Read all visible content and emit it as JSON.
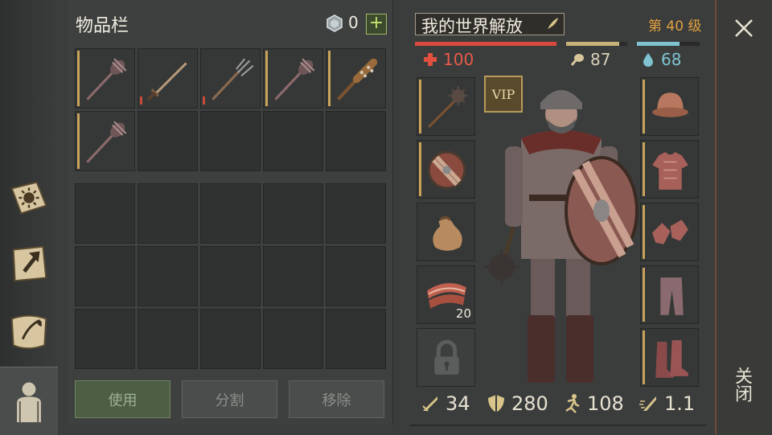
{
  "inventory": {
    "title": "物品栏",
    "currency_count": "0",
    "add_label": "+",
    "items": [
      {
        "icon": "mace-icon",
        "tier": "gold"
      },
      {
        "icon": "sword-icon",
        "tier": "red"
      },
      {
        "icon": "pitchfork-icon",
        "tier": "red"
      },
      {
        "icon": "mace-icon",
        "tier": "gold"
      },
      {
        "icon": "spiked-club-icon",
        "tier": "gold"
      },
      {
        "icon": "mace-icon",
        "tier": "gold"
      }
    ],
    "actions": {
      "use": "使用",
      "split": "分割",
      "remove": "移除"
    }
  },
  "character": {
    "name": "我的世界解放",
    "level": "第 40 级",
    "vip_label": "VIP",
    "health": "100",
    "food": "87",
    "water": "68",
    "health_fraction": 1.0,
    "food_fraction": 0.87,
    "water_fraction": 0.68,
    "left_slots": [
      {
        "icon": "mace-icon",
        "qty": ""
      },
      {
        "icon": "round-shield-icon",
        "qty": ""
      },
      {
        "icon": "sack-icon",
        "qty": ""
      },
      {
        "icon": "meat-icon",
        "qty": "20"
      },
      {
        "icon": "lock-icon",
        "qty": ""
      }
    ],
    "right_slots": [
      {
        "icon": "helmet-icon"
      },
      {
        "icon": "chainmail-icon"
      },
      {
        "icon": "gloves-icon"
      },
      {
        "icon": "trousers-icon"
      },
      {
        "icon": "boots-icon"
      }
    ],
    "stats": {
      "attack": "34",
      "armor": "280",
      "speed": "108",
      "attack_speed": "1.1"
    }
  },
  "close_label": "关闭",
  "colors": {
    "health": "#e85a4a",
    "food": "#c9b27a",
    "water": "#7fc3d1",
    "level": "#e3a040",
    "tier_gold": "#c9a35a",
    "tier_red": "#c94a3a"
  }
}
